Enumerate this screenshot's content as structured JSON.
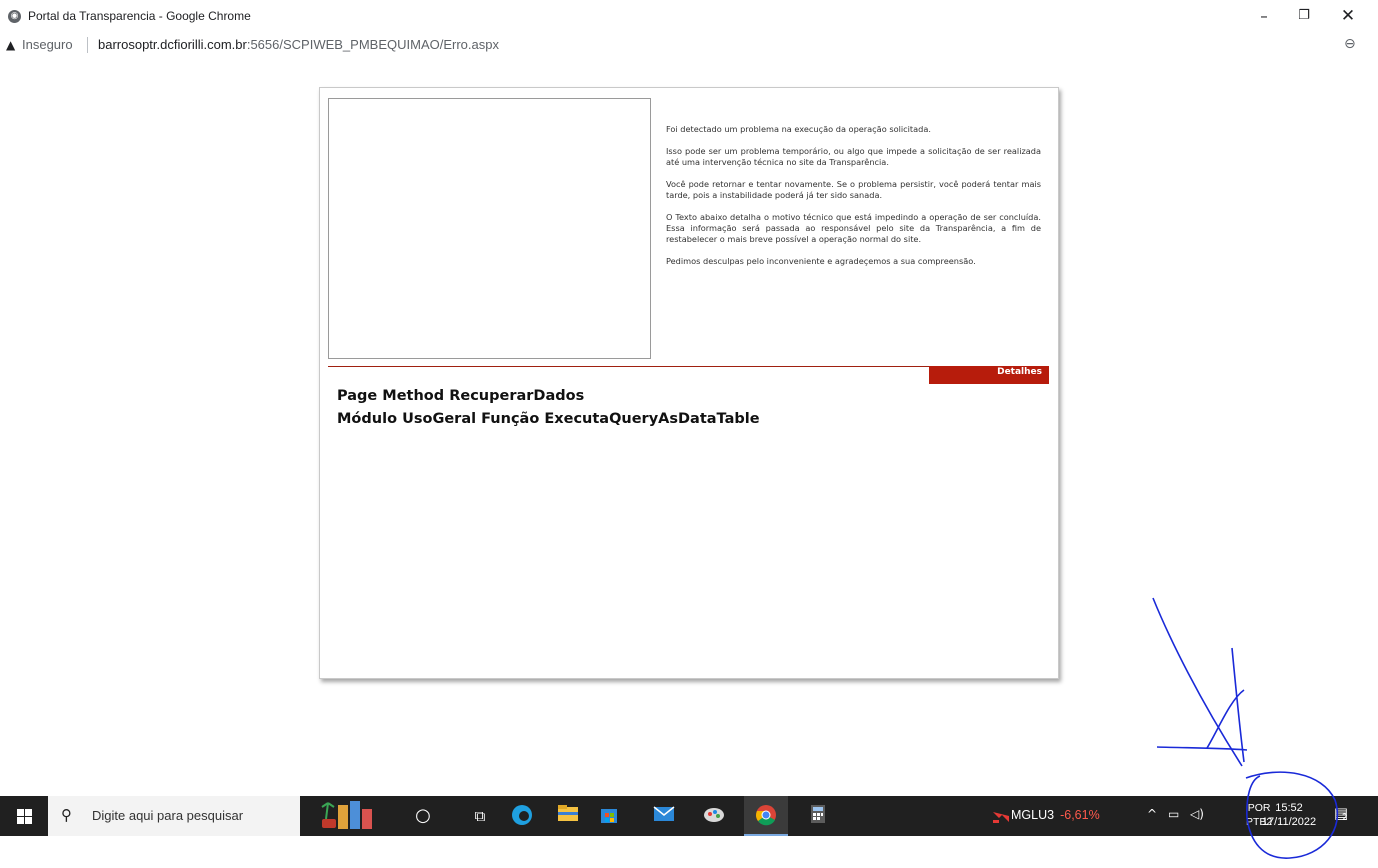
{
  "window": {
    "title": "Portal da Transparencia - Google Chrome",
    "minimize_glyph": "–",
    "maximize_glyph": "❐",
    "close_glyph": "✕"
  },
  "addressbar": {
    "security_label": "Inseguro",
    "url_host": "barrosoptr.dcfiorilli.com.br",
    "url_path": ":5656/SCPIWEB_PMBEQUIMAO/Erro.aspx",
    "zoom_icon": "⊖"
  },
  "error_page": {
    "paragraphs": [
      "Foi detectado um problema na execução da operação solicitada.",
      "Isso pode ser um problema temporário, ou algo que impede a solicitação de ser realizada até uma intervenção técnica no site da Transparência.",
      "Você pode retornar e tentar novamente. Se o problema persistir, você poderá tentar mais tarde, pois a instabilidade poderá já ter sido sanada.",
      "O Texto abaixo detalha o motivo técnico que está impedindo a operação de ser concluída. Essa informação será passada ao responsável pelo site da Transparência, a fim de restabelecer o mais breve possível a operação normal do site.",
      "Pedimos desculpas pelo inconveniente e agradeçemos a sua compreensão."
    ],
    "details_label": "Detalhes",
    "error_line_1": "Page Method RecuperarDados",
    "error_line_2": "Módulo UsoGeral Função ExecutaQueryAsDataTable"
  },
  "taskbar": {
    "search_placeholder": "Digite aqui para pesquisar",
    "stock_symbol": "MGLU3",
    "stock_change": "-6,61%",
    "language_line1": "POR",
    "language_line2": "PTB2",
    "time": "15:52",
    "date": "17/11/2022",
    "notification_count": "2"
  },
  "colors": {
    "details_tab": "#b71c0c",
    "annotation": "#1a2ad8",
    "taskbar": "#202020"
  }
}
